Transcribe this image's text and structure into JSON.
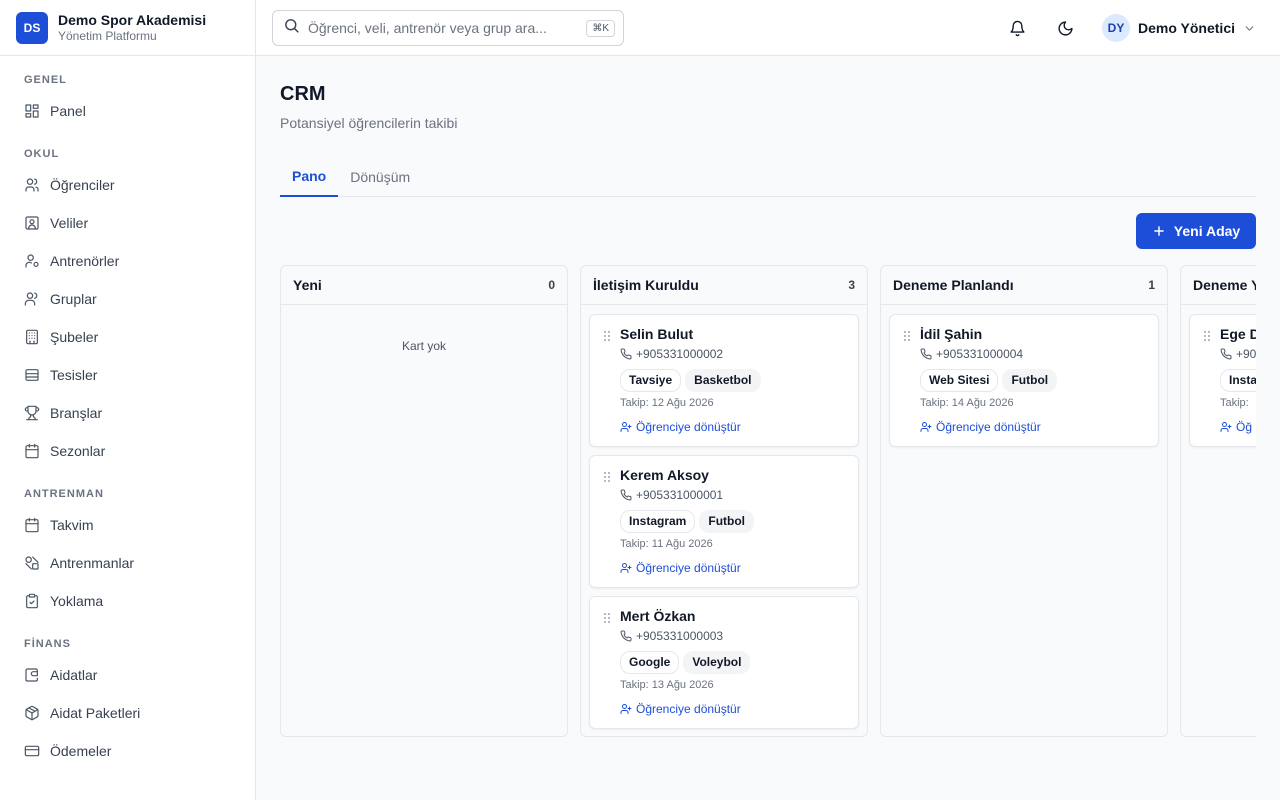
{
  "brand": {
    "initials": "DS",
    "name": "Demo Spor Akademisi",
    "subtitle": "Yönetim Platformu"
  },
  "sidebar": {
    "sections": [
      {
        "title": "GENEL",
        "items": [
          {
            "label": "Panel",
            "icon": "dashboard-icon"
          }
        ]
      },
      {
        "title": "OKUL",
        "items": [
          {
            "label": "Öğrenciler",
            "icon": "users-icon"
          },
          {
            "label": "Veliler",
            "icon": "contact-icon"
          },
          {
            "label": "Antrenörler",
            "icon": "coach-icon"
          },
          {
            "label": "Gruplar",
            "icon": "group-icon"
          },
          {
            "label": "Şubeler",
            "icon": "building-icon"
          },
          {
            "label": "Tesisler",
            "icon": "facility-icon"
          },
          {
            "label": "Branşlar",
            "icon": "trophy-icon"
          },
          {
            "label": "Sezonlar",
            "icon": "calendar-icon"
          }
        ]
      },
      {
        "title": "ANTRENMAN",
        "items": [
          {
            "label": "Takvim",
            "icon": "calendar-icon"
          },
          {
            "label": "Antrenmanlar",
            "icon": "shapes-icon"
          },
          {
            "label": "Yoklama",
            "icon": "clipboard-check-icon"
          }
        ]
      },
      {
        "title": "FİNANS",
        "items": [
          {
            "label": "Aidatlar",
            "icon": "wallet-icon"
          },
          {
            "label": "Aidat Paketleri",
            "icon": "package-icon"
          },
          {
            "label": "Ödemeler",
            "icon": "credit-card-icon"
          }
        ]
      }
    ]
  },
  "topbar": {
    "search_placeholder": "Öğrenci, veli, antrenör veya grup ara...",
    "search_shortcut": "⌘K",
    "user": {
      "initials": "DY",
      "name": "Demo Yönetici"
    }
  },
  "page": {
    "title": "CRM",
    "subtitle": "Potansiyel öğrencilerin takibi",
    "tabs": [
      {
        "label": "Pano",
        "active": true
      },
      {
        "label": "Dönüşüm",
        "active": false
      }
    ],
    "new_button_label": "Yeni Aday"
  },
  "board": {
    "convert_label": "Öğrenciye dönüştür",
    "empty_label": "Kart yok",
    "columns": [
      {
        "title": "Yeni",
        "count": "0",
        "cards": []
      },
      {
        "title": "İletişim Kuruldu",
        "count": "3",
        "cards": [
          {
            "name": "Selin Bulut",
            "phone": "+905331000002",
            "source": "Tavsiye",
            "branch": "Basketbol",
            "follow_up": "Takip: 12 Ağu 2026"
          },
          {
            "name": "Kerem Aksoy",
            "phone": "+905331000001",
            "source": "Instagram",
            "branch": "Futbol",
            "follow_up": "Takip: 11 Ağu 2026"
          },
          {
            "name": "Mert Özkan",
            "phone": "+905331000003",
            "source": "Google",
            "branch": "Voleybol",
            "follow_up": "Takip: 13 Ağu 2026"
          }
        ]
      },
      {
        "title": "Deneme Planlandı",
        "count": "1",
        "cards": [
          {
            "name": "İdil Şahin",
            "phone": "+905331000004",
            "source": "Web Sitesi",
            "branch": "Futbol",
            "follow_up": "Takip: 14 Ağu 2026"
          }
        ]
      },
      {
        "title": "Deneme Y",
        "count": "",
        "cards": [
          {
            "name": "Ege D",
            "phone": "+90",
            "source": "Insta",
            "branch": "",
            "follow_up": "Takip: ",
            "convert": "Öğ"
          }
        ]
      }
    ]
  },
  "colors": {
    "primary": "#1d4ed8",
    "avatar_bg": "#dbeafe"
  }
}
